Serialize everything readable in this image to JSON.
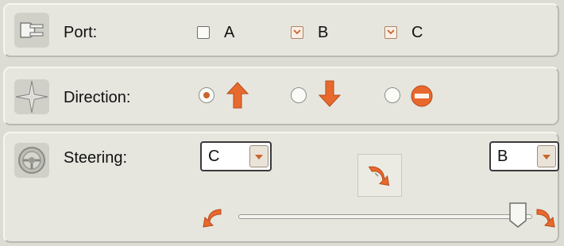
{
  "port": {
    "label": "Port:",
    "icon": "plug-icon",
    "options": [
      {
        "letter": "A",
        "checked": false
      },
      {
        "letter": "B",
        "checked": true
      },
      {
        "letter": "C",
        "checked": true
      }
    ]
  },
  "direction": {
    "label": "Direction:",
    "icon": "compass-star-icon",
    "options": [
      {
        "name": "forward",
        "icon": "arrow-up-icon",
        "selected": true
      },
      {
        "name": "backward",
        "icon": "arrow-down-icon",
        "selected": false
      },
      {
        "name": "stop",
        "icon": "stop-icon",
        "selected": false
      }
    ]
  },
  "steering": {
    "label": "Steering:",
    "icon": "steering-wheel-icon",
    "left_select": "C",
    "right_select": "B",
    "swap_icon": "swap-motors-icon",
    "slider_value": 1.0,
    "slider_left_icon": "turn-left-icon",
    "slider_right_icon": "turn-right-icon"
  },
  "colors": {
    "accent": "#e8692e",
    "panel": "#e6e6de"
  }
}
